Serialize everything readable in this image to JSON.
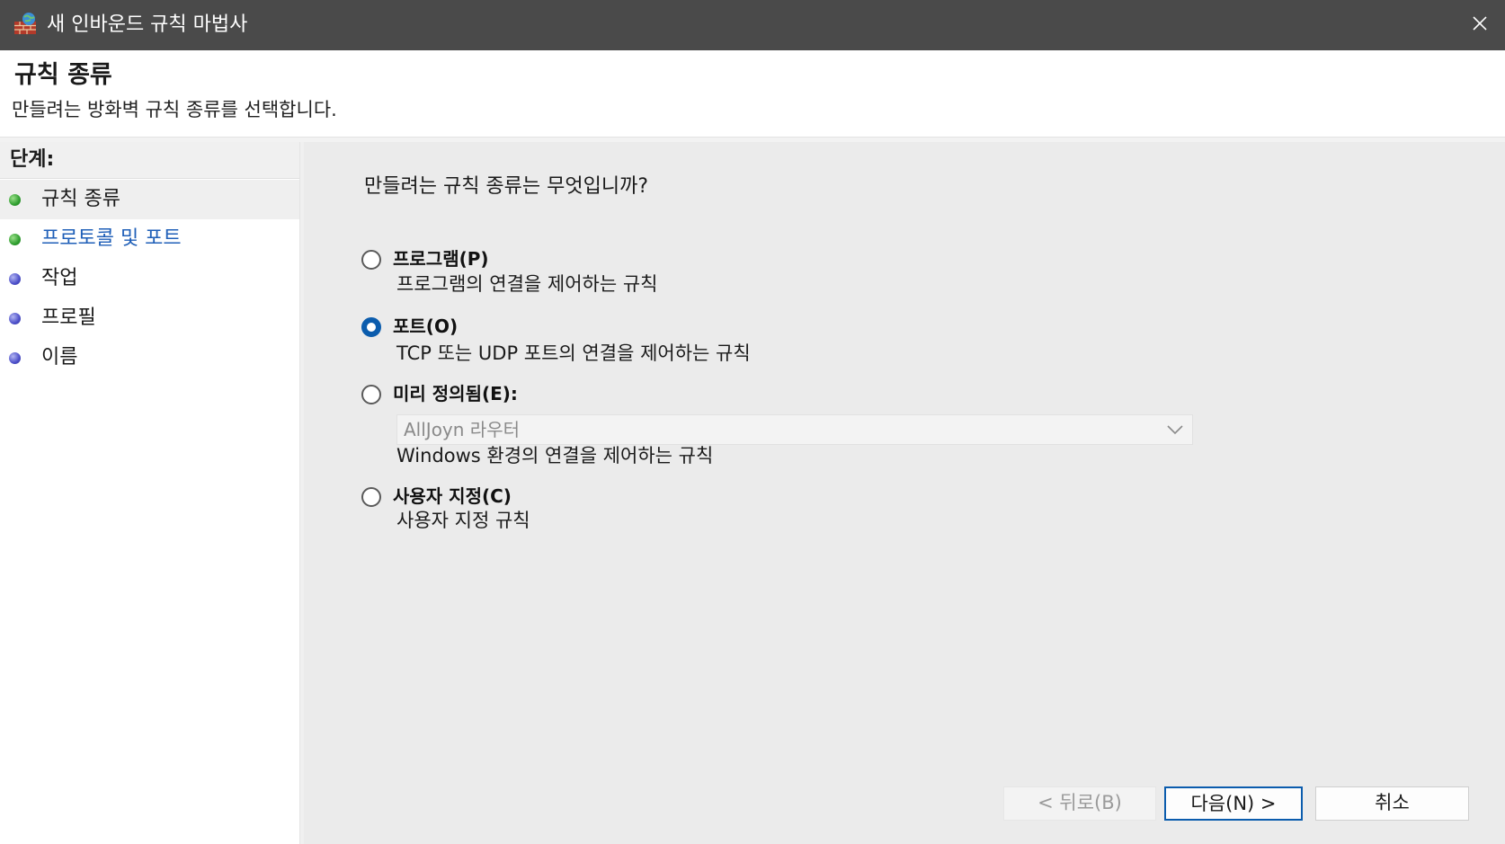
{
  "window": {
    "title": "새 인바운드 규칙 마법사",
    "close_icon": "close-icon",
    "app_icon": "firewall-icon"
  },
  "header": {
    "title": "규칙 종류",
    "description": "만들려는 방화벽 규칙 종류를 선택합니다."
  },
  "sidebar": {
    "steps_label": "단계:",
    "steps": [
      {
        "label": "규칙 종류",
        "status": "complete",
        "active": true
      },
      {
        "label": "프로토콜 및 포트",
        "status": "complete",
        "active": false
      },
      {
        "label": "작업",
        "status": "pending",
        "active": false
      },
      {
        "label": "프로필",
        "status": "pending",
        "active": false
      },
      {
        "label": "이름",
        "status": "pending",
        "active": false
      }
    ]
  },
  "main": {
    "question": "만들려는 규칙 종류는 무엇입니까?",
    "options": [
      {
        "label": "프로그램(P)",
        "description": "프로그램의 연결을 제어하는 규칙",
        "checked": false
      },
      {
        "label": "포트(O)",
        "description": "TCP 또는 UDP 포트의 연결을 제어하는 규칙",
        "checked": true
      },
      {
        "label": "미리 정의됨(E):",
        "description": "Windows 환경의 연결을 제어하는 규칙",
        "checked": false
      },
      {
        "label": "사용자 지정(C)",
        "description": "사용자 지정 규칙",
        "checked": false
      }
    ],
    "predefined_dropdown": {
      "value": "AllJoyn 라우터",
      "disabled": true
    }
  },
  "buttons": {
    "back": "< 뒤로(B)",
    "next": "다음(N) >",
    "cancel": "취소"
  },
  "colors": {
    "titlebar": "#4a4a4a",
    "accent": "#0b5cad",
    "link": "#1f5fb8",
    "step_complete": "#2f9e2f",
    "step_pending": "#4c4fc9"
  }
}
